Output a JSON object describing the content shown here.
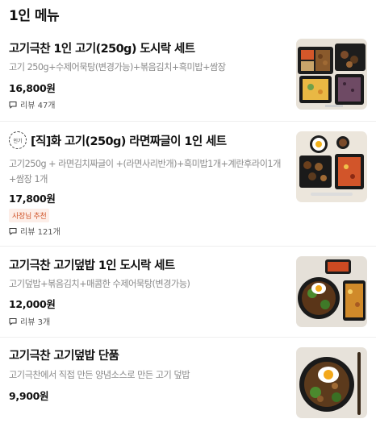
{
  "section": {
    "title": "1인 메뉴"
  },
  "items": [
    {
      "name": "고기극찬 1인 고기(250g) 도시락 세트",
      "desc": "고기 250g+수제어묵탕(변경가능)+볶음김치+흑미밥+쌈장",
      "price": "16,800원",
      "review": "리뷰 47개"
    },
    {
      "badge": "인기",
      "name": "[직]화 고기(250g) 라면짜글이 1인 세트",
      "desc": "고기250g + 라면김치짜글이 +(라면사리반개)+흑미밥1개+계란후라이1개+쌈장 1개",
      "price": "17,800원",
      "owner_badge": "사장님 추천",
      "review": "리뷰 121개"
    },
    {
      "name": "고기극찬 고기덮밥 1인 도시락 세트",
      "desc": "고기덮밥+볶음김치+매콤한 수제어묵탕(변경가능)",
      "price": "12,000원",
      "review": "리뷰 3개"
    },
    {
      "name": "고기극찬 고기덮밥 단품",
      "desc": "고기극찬에서 직접 만든 양념소스로 만든 고기 덮밥",
      "price": "9,900원"
    }
  ]
}
